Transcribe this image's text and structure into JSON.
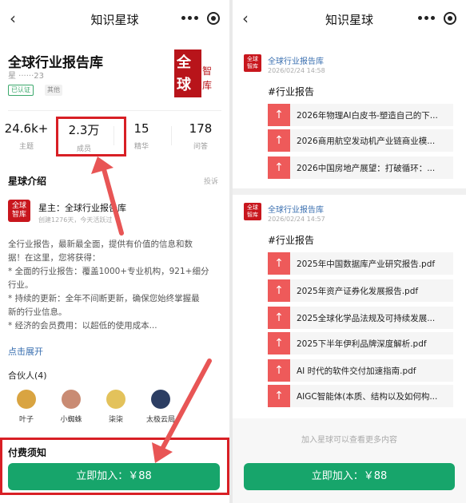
{
  "left": {
    "header": {
      "title": "知识星球"
    },
    "planet": {
      "name": "全球行业报告库",
      "owner_id": "星 ······23",
      "verified": "已认证",
      "tag": "其他"
    },
    "logo": {
      "c1": "全",
      "c2": "球",
      "c3": "智",
      "c4": "库"
    },
    "stats": [
      {
        "value": "24.6k+",
        "label": "主题"
      },
      {
        "value": "2.3万",
        "label": "成员"
      },
      {
        "value": "15",
        "label": "精华"
      },
      {
        "value": "178",
        "label": "问答"
      }
    ],
    "intro": {
      "title": "星球介绍",
      "report": "投诉",
      "owner_avatar": "全球 智库",
      "owner_name": "星主：全球行业报告库",
      "owner_meta": "创建1276天，今天活跃过",
      "lines": [
        "全行业报告，最新最全面，提供有价值的信息和数",
        "据！在这里，您将获得：",
        "* 全面的行业报告：覆盖1000+专业机构，921+细分",
        "行业。",
        "* 持续的更新：全年不间断更新，确保您始终掌握最",
        "新的行业信息。",
        "* 经济的会员费用：以超低的使用成本..."
      ],
      "expand": "点击展开"
    },
    "partners": {
      "title": "合伙人(4)",
      "people": [
        {
          "name": "叶子",
          "color": "#d9a441"
        },
        {
          "name": "小蜘蛛",
          "color": "#c98b73"
        },
        {
          "name": "柒柒",
          "color": "#e3c25b"
        },
        {
          "name": "太极云局",
          "color": "#2c3e63"
        }
      ]
    },
    "pay_title": "付费须知",
    "join_button": "立即加入：￥88"
  },
  "right": {
    "header": {
      "title": "知识星球"
    },
    "posts": [
      {
        "avatar": "全球 智库",
        "author": "全球行业报告库",
        "date": "2026/02/24 14:58",
        "tag": "#行业报告",
        "files": [
          "2026年物理AI白皮书-塑造自己的下...",
          "2026商用航空发动机产业链商业模...",
          "2026中国房地产展望：打破循环：..."
        ]
      },
      {
        "avatar": "全球 智库",
        "author": "全球行业报告库",
        "date": "2026/02/24 14:57",
        "tag": "#行业报告",
        "files": [
          "2025年中国数据库产业研究报告.pdf",
          "2025年资产证券化发展报告.pdf",
          "2025全球化学品法规及可持续发展...",
          "2025下半年伊利品牌深度解析.pdf",
          "AI 时代的软件交付加速指南.pdf",
          "AIGC智能体(本质、结构以及如何构..."
        ]
      }
    ],
    "more_hint": "加入星球可以查看更多内容",
    "join_button": "立即加入：￥88"
  },
  "colors": {
    "accent": "#17a56b",
    "highlight": "#d81f25",
    "pdf": "#ee5a5a",
    "brand": "#c8161d"
  },
  "icons": {
    "back": "chevron-left-icon",
    "menu": "more-dots-icon",
    "target": "target-icon",
    "pdf": "pdf-icon"
  }
}
